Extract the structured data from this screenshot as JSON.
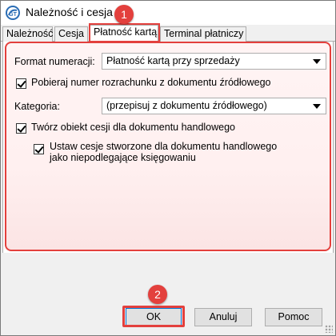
{
  "window": {
    "title": "Należność i cesja",
    "icon": "app-logo-icon"
  },
  "tabs": [
    {
      "label": "Należność",
      "active": false
    },
    {
      "label": "Cesja",
      "active": false
    },
    {
      "label": "Płatność kartą",
      "active": true
    },
    {
      "label": "Terminal płatniczy",
      "active": false
    }
  ],
  "form": {
    "format_label": "Format numeracji:",
    "format_value": "Płatność kartą przy sprzedaży",
    "fetch_number_label": "Pobieraj numer rozrachunku z dokumentu źródłowego",
    "fetch_number_checked": true,
    "category_label": "Kategoria:",
    "category_value": "(przepisuj z dokumentu źródłowego)",
    "create_cession_label": "Twórz obiekt cesji dla dokumentu handlowego",
    "create_cession_checked": true,
    "independent_line1": "Ustaw cesje stworzone dla dokumentu handlowego",
    "independent_line2": "jako niepodlegające księgowaniu",
    "independent_checked": true
  },
  "buttons": {
    "ok": "OK",
    "cancel": "Anuluj",
    "help": "Pomoc"
  },
  "annotations": {
    "step1": "1",
    "step2": "2",
    "color": "#e3403d"
  }
}
